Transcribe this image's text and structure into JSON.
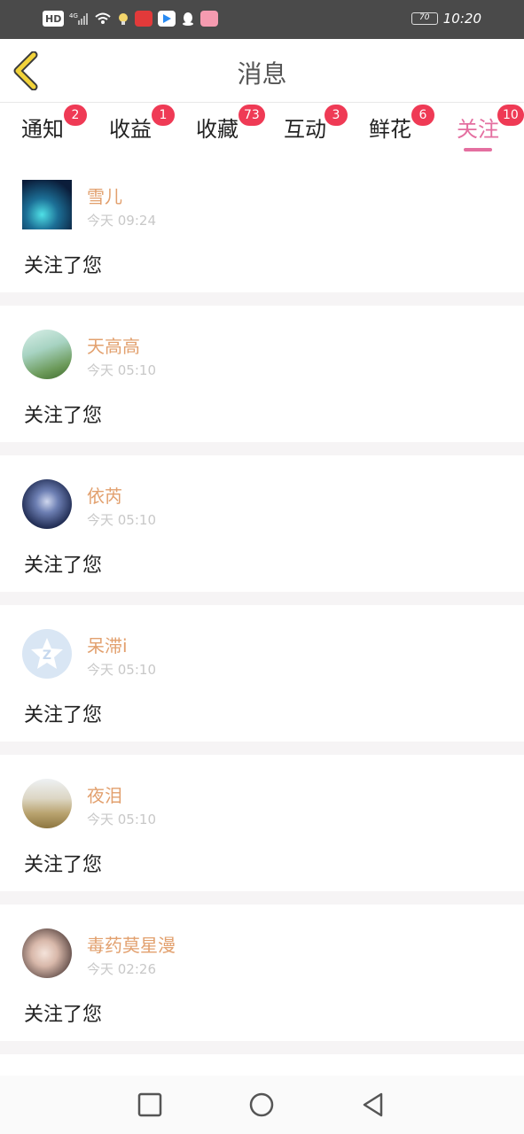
{
  "status_bar": {
    "network": "HD",
    "signal_label": "4G",
    "battery": "70",
    "time": "10:20"
  },
  "header": {
    "title": "消息"
  },
  "tabs": [
    {
      "label": "通知",
      "badge": "2"
    },
    {
      "label": "收益",
      "badge": "1"
    },
    {
      "label": "收藏",
      "badge": "73"
    },
    {
      "label": "互动",
      "badge": "3"
    },
    {
      "label": "鲜花",
      "badge": "6"
    },
    {
      "label": "关注",
      "badge": "10",
      "active": true
    }
  ],
  "feed": [
    {
      "name": "雪儿",
      "time": "今天 09:24",
      "message": "关注了您"
    },
    {
      "name": "天高高",
      "time": "今天 05:10",
      "message": "关注了您"
    },
    {
      "name": "依芮",
      "time": "今天 05:10",
      "message": "关注了您"
    },
    {
      "name": "呆滞i",
      "time": "今天 05:10",
      "message": "关注了您"
    },
    {
      "name": "夜泪",
      "time": "今天 05:10",
      "message": "关注了您"
    },
    {
      "name": "毒药莫星漫",
      "time": "今天 02:26",
      "message": "关注了您"
    }
  ],
  "colors": {
    "accent": "#e46fa0",
    "badge": "#ef3a55",
    "name": "#e2a06e",
    "back_arrow": "#f2d33a"
  }
}
